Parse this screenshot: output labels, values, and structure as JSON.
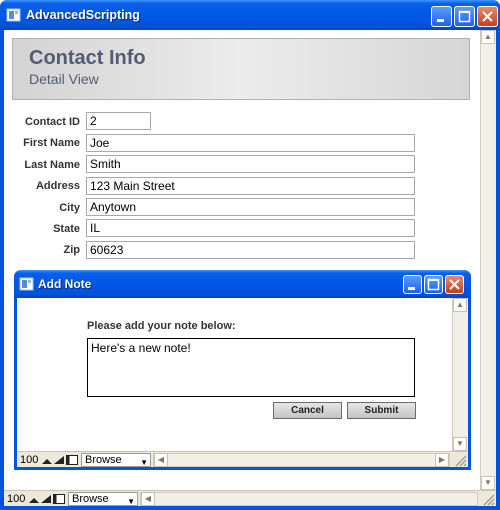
{
  "main_window": {
    "title": "AdvancedScripting",
    "header_title": "Contact Info",
    "header_subtitle": "Detail View",
    "fields": [
      {
        "label": "Contact ID",
        "value": "2"
      },
      {
        "label": "First Name",
        "value": "Joe"
      },
      {
        "label": "Last Name",
        "value": "Smith"
      },
      {
        "label": "Address",
        "value": "123 Main Street"
      },
      {
        "label": "City",
        "value": "Anytown"
      },
      {
        "label": "State",
        "value": "IL"
      },
      {
        "label": "Zip",
        "value": "60623"
      }
    ],
    "status_bar": {
      "zoom": "100",
      "mode": "Browse"
    }
  },
  "dialog": {
    "title": "Add Note",
    "prompt": "Please add your note below:",
    "note_text": "Here's a new note!",
    "cancel_label": "Cancel",
    "submit_label": "Submit",
    "status_bar": {
      "zoom": "100",
      "mode": "Browse"
    }
  },
  "colors": {
    "title_bar": "#0054e3",
    "header_text": "#535c73",
    "status_bar": "#ece9d8"
  }
}
